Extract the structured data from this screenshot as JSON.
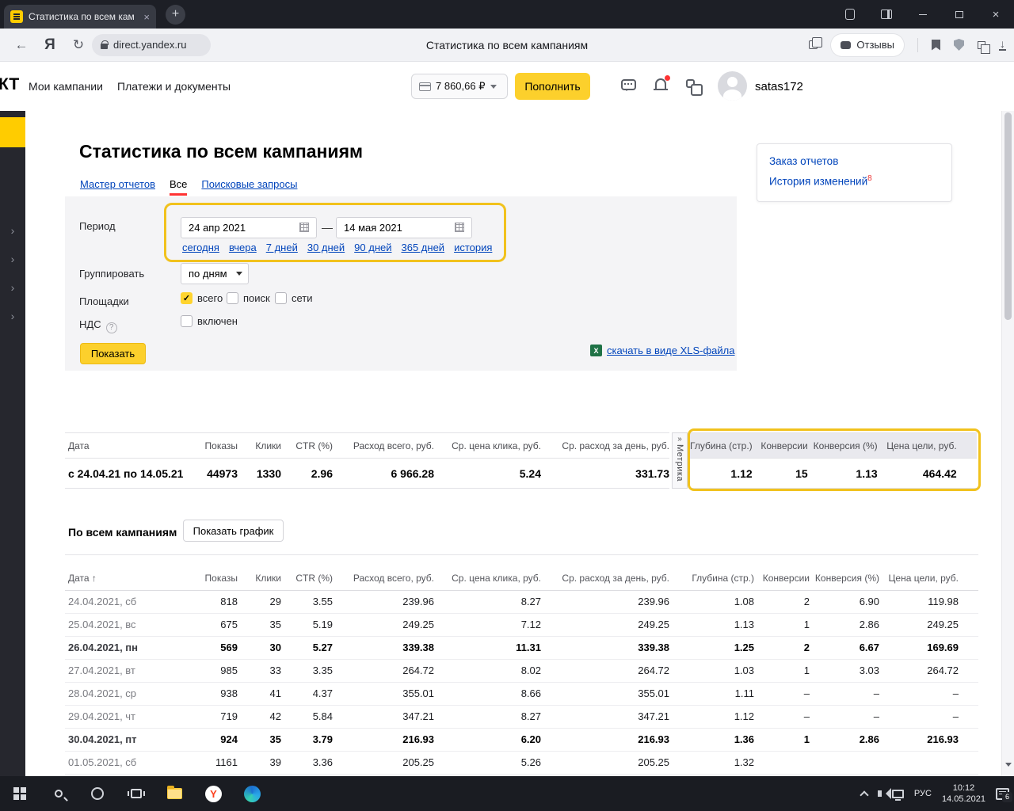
{
  "browser": {
    "tab_title": "Статистика по всем кам",
    "tab_close": "×",
    "new_tab": "+",
    "back": "←",
    "refresh": "↻",
    "url": "direct.yandex.ru",
    "page_title": "Статистика по всем кампаниям",
    "reviews_label": "Отзывы",
    "download_glyph": "↓",
    "close_glyph": "×"
  },
  "site_header": {
    "logo": "КТ",
    "nav": [
      "Мои кампании",
      "Платежи и документы"
    ],
    "balance": "7 860,66 ₽",
    "topup": "Пополнить",
    "username": "satas172"
  },
  "rail": {
    "chevron": "›"
  },
  "page": {
    "title": "Статистика по всем кампаниям",
    "tabs": [
      "Мастер отчетов",
      "Все",
      "Поисковые запросы"
    ],
    "form": {
      "period_label": "Период",
      "date_from": "24 апр 2021",
      "dash": "—",
      "date_to": "14 мая 2021",
      "quick_links": [
        "сегодня",
        "вчера",
        "7 дней",
        "30 дней",
        "90 дней",
        "365 дней",
        "история"
      ],
      "group_label": "Группировать",
      "group_value": "по дням",
      "platforms_label": "Площадки",
      "platforms": [
        {
          "label": "всего",
          "checked": true
        },
        {
          "label": "поиск",
          "checked": false
        },
        {
          "label": "сети",
          "checked": false
        }
      ],
      "check_glyph": "✓",
      "vat_label": "НДС",
      "vat_help": "?",
      "vat_option": "включен",
      "show_button": "Показать",
      "xls_icon": "X",
      "xls_link": "скачать в виде XLS-файла"
    },
    "reports_card": {
      "order": "Заказ отчетов",
      "history": "История изменений",
      "badge": "8"
    },
    "metrika": {
      "expand": "»",
      "label": "Метрика"
    }
  },
  "summary_table": {
    "columns_left": [
      "Дата",
      "Показы",
      "Клики",
      "CTR (%)",
      "Расход всего, руб.",
      "Ср. цена клика, руб.",
      "Ср. расход за день, руб."
    ],
    "columns_right": [
      "Глубина (стр.)",
      "Конверсии",
      "Конверсия (%)",
      "Цена цели, руб."
    ],
    "row_label": "с 24.04.21 по 14.05.21",
    "values_left": [
      "44973",
      "1330",
      "2.96",
      "6 966.28",
      "5.24",
      "331.73"
    ],
    "values_right": [
      "1.12",
      "15",
      "1.13",
      "464.42"
    ]
  },
  "campaigns_section": {
    "title": "По всем кампаниям",
    "chart_button": "Показать график"
  },
  "detail_table": {
    "columns": [
      "Дата ↑",
      "Показы",
      "Клики",
      "CTR (%)",
      "Расход всего, руб.",
      "Ср. цена клика, руб.",
      "Ср. расход за день, руб.",
      "Глубина (стр.)",
      "Конверсии",
      "Конверсия (%)",
      "Цена цели, руб."
    ],
    "rows": [
      [
        "24.04.2021, сб",
        "818",
        "29",
        "3.55",
        "239.96",
        "8.27",
        "239.96",
        "1.08",
        "2",
        "6.90",
        "119.98"
      ],
      [
        "25.04.2021, вс",
        "675",
        "35",
        "5.19",
        "249.25",
        "7.12",
        "249.25",
        "1.13",
        "1",
        "2.86",
        "249.25"
      ],
      [
        "26.04.2021, пн",
        "569",
        "30",
        "5.27",
        "339.38",
        "11.31",
        "339.38",
        "1.25",
        "2",
        "6.67",
        "169.69"
      ],
      [
        "27.04.2021, вт",
        "985",
        "33",
        "3.35",
        "264.72",
        "8.02",
        "264.72",
        "1.03",
        "1",
        "3.03",
        "264.72"
      ],
      [
        "28.04.2021, ср",
        "938",
        "41",
        "4.37",
        "355.01",
        "8.66",
        "355.01",
        "1.11",
        "–",
        "–",
        "–"
      ],
      [
        "29.04.2021, чт",
        "719",
        "42",
        "5.84",
        "347.21",
        "8.27",
        "347.21",
        "1.12",
        "–",
        "–",
        "–"
      ],
      [
        "30.04.2021, пт",
        "924",
        "35",
        "3.79",
        "216.93",
        "6.20",
        "216.93",
        "1.36",
        "1",
        "2.86",
        "216.93"
      ],
      [
        "01.05.2021, сб",
        "1161",
        "39",
        "3.36",
        "205.25",
        "5.26",
        "205.25",
        "1.32",
        "",
        "",
        ""
      ]
    ],
    "bold_rows": [
      2,
      6
    ]
  },
  "taskbar": {
    "lang": "РУС",
    "time": "10:12",
    "date": "14.05.2021",
    "badge": "6"
  },
  "colors": {
    "accent_yellow": "#fcd02c",
    "highlight_gold": "#f1c21d",
    "link_blue": "#0044bb",
    "active_tab_red": "#ff3333"
  }
}
